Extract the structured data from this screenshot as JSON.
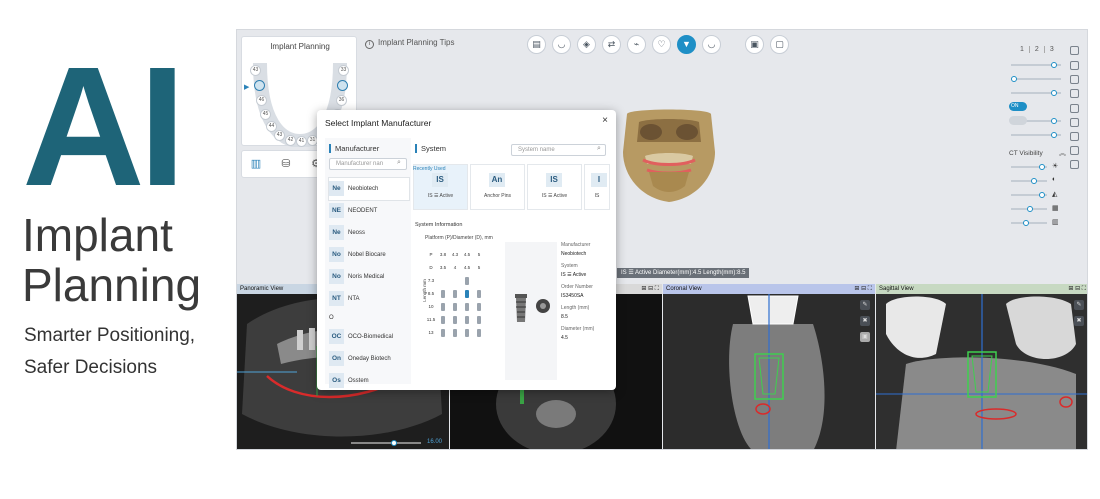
{
  "branding": {
    "headline": "AI",
    "title_line1": "Implant",
    "title_line2": "Planning",
    "subtitle_line1": "Smarter Positioning,",
    "subtitle_line2": "Safer Decisions"
  },
  "app": {
    "implant_panel": {
      "title": "Implant Planning",
      "teeth": [
        "43",
        "46",
        "45",
        "44",
        "43",
        "42",
        "41",
        "31",
        "32",
        "35",
        "36",
        "33"
      ]
    },
    "tips": "Implant Planning Tips",
    "layout_tabs": [
      "1",
      "2",
      "3"
    ],
    "ct_visibility": "CT Visibility",
    "toggle_on": "ON",
    "status": "IS ☰ Active   Diameter(mm):4.5   Length(mm):8.5",
    "views": {
      "panoramic": "Panoramic View",
      "axial": "",
      "coronal": "Coronal View",
      "sagittal": "Sagittal View"
    },
    "pano_slider_value": "16.00"
  },
  "modal": {
    "title": "Select Implant Manufacturer",
    "close": "×",
    "manufacturer_heading": "Manufacturer",
    "manufacturer_search_placeholder": "Manufacturer nan",
    "manufacturers": [
      {
        "abbr": "Ne",
        "name": "Neobiotech"
      },
      {
        "abbr": "NE",
        "name": "NEODENT"
      },
      {
        "abbr": "Ne",
        "name": "Neoss"
      },
      {
        "abbr": "No",
        "name": "Nobel Biocare"
      },
      {
        "abbr": "No",
        "name": "Noris Medical"
      },
      {
        "abbr": "NT",
        "name": "NTA"
      },
      {
        "abbr": "",
        "name": "O"
      },
      {
        "abbr": "OC",
        "name": "OCO-Biomedical"
      },
      {
        "abbr": "On",
        "name": "Oneday Biotech"
      },
      {
        "abbr": "Os",
        "name": "Osstem"
      }
    ],
    "system_heading": "System",
    "system_search_placeholder": "System name",
    "recently_used": "Recently Used",
    "systems": [
      {
        "abbr": "IS",
        "name": "IS ☰ Active"
      },
      {
        "abbr": "An",
        "name": "Anchor Pins"
      },
      {
        "abbr": "IS",
        "name": "IS ☰ Active"
      },
      {
        "abbr": "I",
        "name": "IS"
      }
    ],
    "system_information": "System Information",
    "platform_label": "Platform (P)/Diameter (D), mm",
    "length_label": "Length mm",
    "grid_header_p": [
      "P",
      "3.8",
      "4.3",
      "4.5",
      "5"
    ],
    "grid_header_d": [
      "D",
      "3.5",
      "4",
      "4.5",
      "5"
    ],
    "lengths": [
      "7.3",
      "8.5",
      "10",
      "11.5",
      "13"
    ],
    "details": {
      "manufacturer_label": "Manufacturer",
      "manufacturer": "Neobiotech",
      "system_label": "System",
      "system": "IS ☰ Active",
      "order_label": "Order Number",
      "order": "IS3450SA",
      "length_label": "Length (mm)",
      "length": "8.5",
      "diameter_label": "Diameter (mm)",
      "diameter": "4.5"
    }
  },
  "colors": {
    "brand": "#1e6478",
    "accent": "#1e8fc6"
  }
}
